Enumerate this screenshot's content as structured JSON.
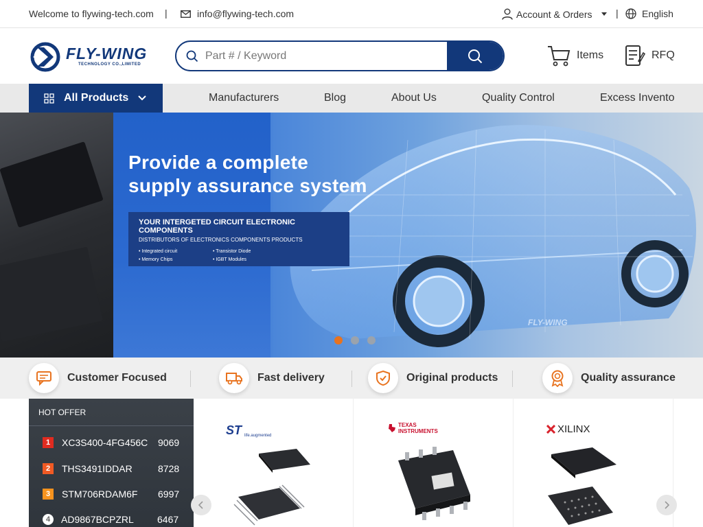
{
  "topbar": {
    "welcome": "Welcome to flywing-tech.com",
    "email": "info@flywing-tech.com",
    "account": "Account & Orders",
    "language": "English"
  },
  "header": {
    "logo_text": "FLY-WING",
    "logo_sub": "TECHNOLOGY CO.,LIMITED",
    "search_placeholder": "Part # / Keyword",
    "items_label": "Items",
    "rfq_label": "RFQ"
  },
  "nav": {
    "all_products": "All Products",
    "items": [
      "Manufacturers",
      "Blog",
      "About Us",
      "Quality Control",
      "Excess Invento"
    ]
  },
  "banner": {
    "title_line1": "Provide a complete",
    "title_line2": "supply assurance system",
    "box_title": "YOUR INTERGETED CIRCUIT ELECTRONIC COMPONENTS",
    "box_sub": "DISTRIBUTORS OF ELECTRONICS COMPONENTS PRODUCTS",
    "bullets": [
      "• Integrated circuit",
      "• Transistor Diode",
      "• Memory Chips",
      "• IGBT Modules"
    ],
    "watermark": "FLY-WING"
  },
  "features": [
    "Customer Focused",
    "Fast delivery",
    "Original products",
    "Quality assurance"
  ],
  "hot_offer": {
    "title": "HOT OFFER",
    "rows": [
      {
        "rank": "1",
        "part": "XC3S400-4FG456C",
        "qty": "9069"
      },
      {
        "rank": "2",
        "part": "THS3491IDDAR",
        "qty": "8728"
      },
      {
        "rank": "3",
        "part": "STM706RDAM6F",
        "qty": "6997"
      },
      {
        "rank": "4",
        "part": "AD9867BCPZRL",
        "qty": "6467"
      }
    ]
  },
  "products": {
    "brands": [
      "ST",
      "TEXAS INSTRUMENTS",
      "XILINX"
    ],
    "st_tagline": "life.augmented"
  },
  "colors": {
    "brand_blue": "#12387a",
    "accent_orange": "#e8731f"
  }
}
